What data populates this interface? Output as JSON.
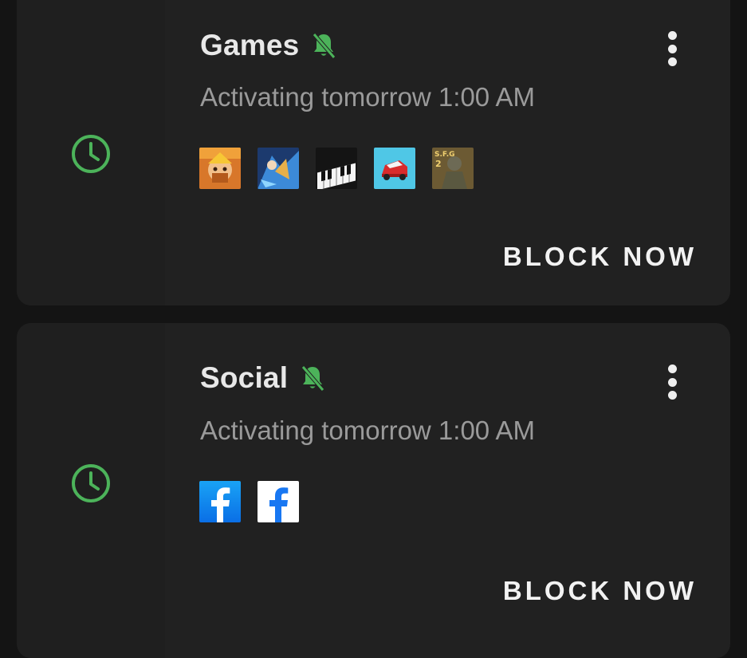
{
  "profiles": [
    {
      "title": "Games",
      "subtitle": "Activating tomorrow 1:00 AM",
      "status_icon": "clock-icon",
      "notification_icon": "bell-off-icon",
      "apps": [
        "clash-of-clans-app-icon",
        "mobile-legends-app-icon",
        "piano-app-icon",
        "car-game-app-icon",
        "shooter-game-app-icon"
      ],
      "app_icon_text": "S.F.G\n2",
      "action_label": "BLOCK NOW"
    },
    {
      "title": "Social",
      "subtitle": "Activating tomorrow 1:00 AM",
      "status_icon": "clock-icon",
      "notification_icon": "bell-off-icon",
      "apps": [
        "facebook-app-icon",
        "facebook-lite-app-icon"
      ],
      "action_label": "BLOCK NOW"
    }
  ],
  "colors": {
    "background": "#141414",
    "card": "#212121",
    "accent_green": "#4cb35a",
    "title_text": "#e8e8e8",
    "subtitle_text": "#9a9a9a"
  }
}
